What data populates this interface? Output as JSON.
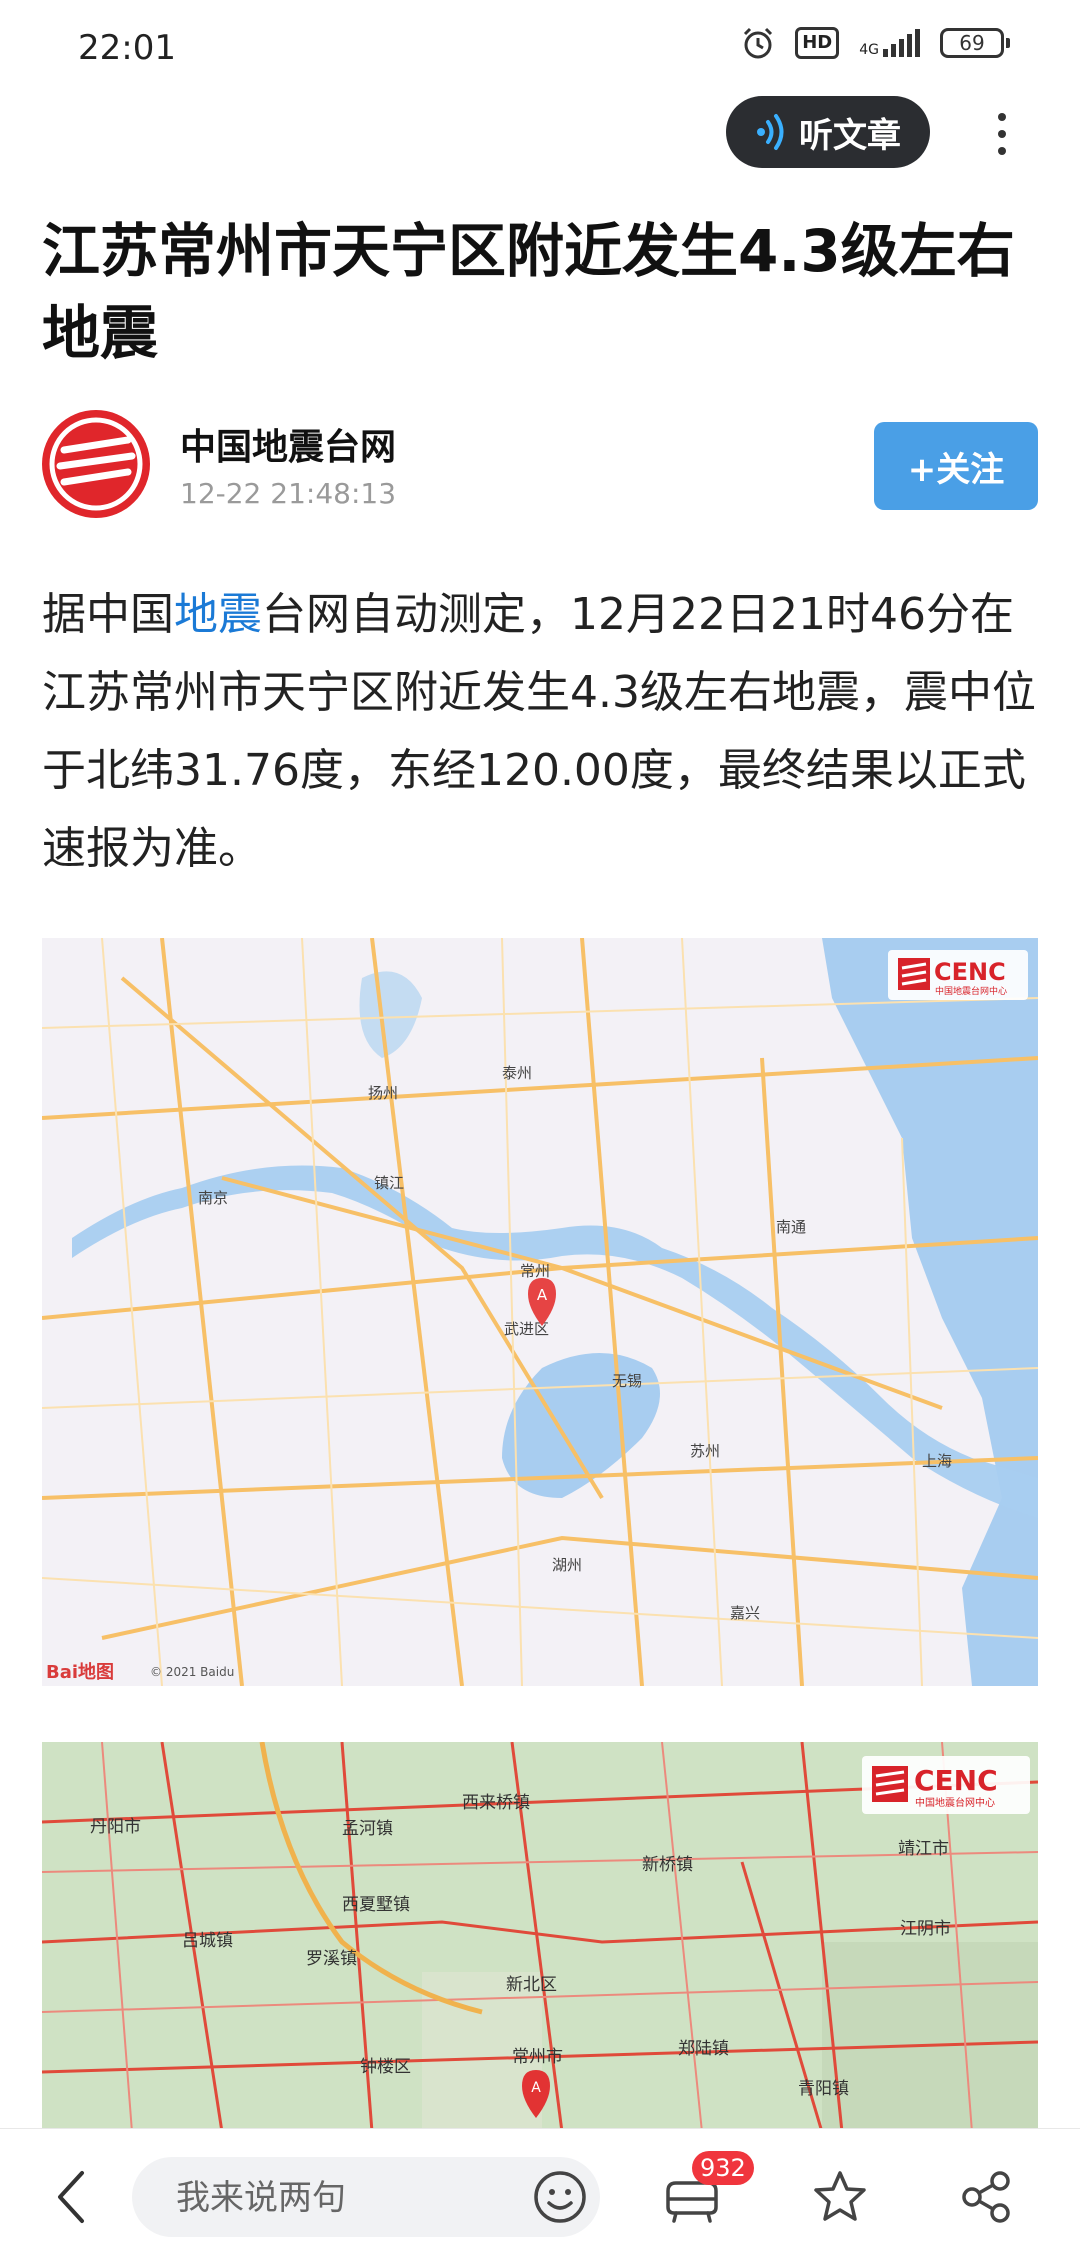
{
  "status_bar": {
    "time": "22:01",
    "hd": "HD",
    "network": "4G",
    "battery": "69"
  },
  "toolbar": {
    "listen_label": "听文章"
  },
  "article": {
    "title": "江苏常州市天宁区附近发生4.3级左右地震",
    "author": "中国地震台网",
    "published": "12-22 21:48:13",
    "follow_label": "+关注",
    "body_before": "据中国",
    "body_keyword": "地震",
    "body_after": "台网自动测定，12月22日21时46分在江苏常州市天宁区附近发生4.3级左右地震，震中位于北纬31.76度，东经120.00度，最终结果以正式速报为准。"
  },
  "map1": {
    "badge": "CENC",
    "badge_sub": "中国地震台网中心",
    "marker": "A",
    "copyright": "© 2021 Baidu",
    "logo": "Bai地图",
    "labels": [
      "南京",
      "扬州",
      "镇江",
      "泰州",
      "常州",
      "无锡",
      "苏州",
      "上海",
      "南通",
      "武进区",
      "湖州",
      "嘉兴"
    ]
  },
  "map2": {
    "badge": "CENC",
    "badge_sub": "中国地震台网中心",
    "marker": "A",
    "labels": [
      "丹阳市",
      "常州市",
      "江阴市",
      "新北区",
      "钟楼区",
      "靖江市",
      "郑陆镇",
      "西夏墅镇",
      "孟河镇",
      "罗溪镇",
      "西来桥镇",
      "新桥镇",
      "吕城镇",
      "青阳镇"
    ]
  },
  "bottom_bar": {
    "comment_placeholder": "我来说两句",
    "comment_count": "932"
  }
}
